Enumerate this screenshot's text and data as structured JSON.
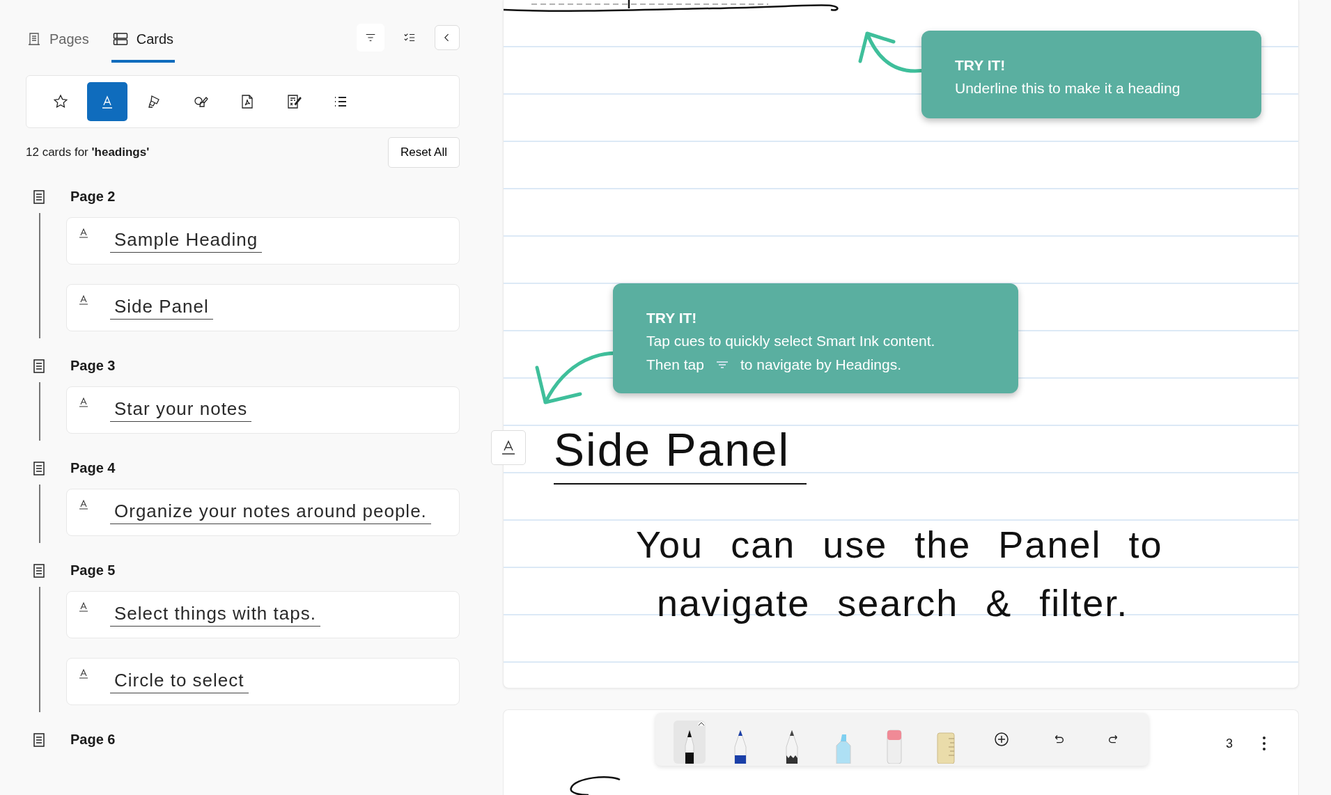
{
  "sidebar": {
    "tabs": [
      {
        "label": "Pages",
        "selected": false,
        "kind": "pages"
      },
      {
        "label": "Cards",
        "selected": true,
        "kind": "cards"
      }
    ],
    "filters": [
      {
        "kind": "star",
        "selected": false
      },
      {
        "kind": "heading",
        "selected": true
      },
      {
        "kind": "highlighter",
        "selected": false
      },
      {
        "kind": "shapes",
        "selected": false
      },
      {
        "kind": "pdf",
        "selected": false
      },
      {
        "kind": "math",
        "selected": false
      },
      {
        "kind": "list",
        "selected": false
      }
    ],
    "result_text": "12 cards for **'headings'**",
    "reset_button": "Reset All",
    "groups": [
      {
        "page": "Page 2",
        "cards": [
          "Sample Heading",
          "Side Panel"
        ]
      },
      {
        "page": "Page 3",
        "cards": [
          "Star your notes"
        ]
      },
      {
        "page": "Page 4",
        "cards": [
          "Organize your notes around people."
        ]
      },
      {
        "page": "Page 5",
        "cards": [
          "Select things with taps.",
          "Circle to select"
        ]
      },
      {
        "page": "Page 6"
      }
    ]
  },
  "canvas": {
    "tips": [
      {
        "title": "TRY IT!",
        "text": "Underline this to make it a heading"
      },
      {
        "title": "TRY IT!",
        "text": "Tap cues to quickly select Smart Ink content.",
        "tap_prefix": "Then tap",
        "tap_suffix": "to navigate by Headings."
      }
    ],
    "heading": "Side Panel",
    "body": [
      "You can use the Panel to",
      "navigate search & filter."
    ]
  },
  "toolbar": {
    "tools": [
      {
        "kind": "marker",
        "selected": true
      },
      {
        "kind": "pen",
        "selected": false
      },
      {
        "kind": "pencil",
        "selected": false
      },
      {
        "kind": "highlighter",
        "selected": false
      },
      {
        "kind": "eraser",
        "selected": false
      },
      {
        "kind": "ruler",
        "selected": false
      }
    ]
  },
  "page_number": "3"
}
